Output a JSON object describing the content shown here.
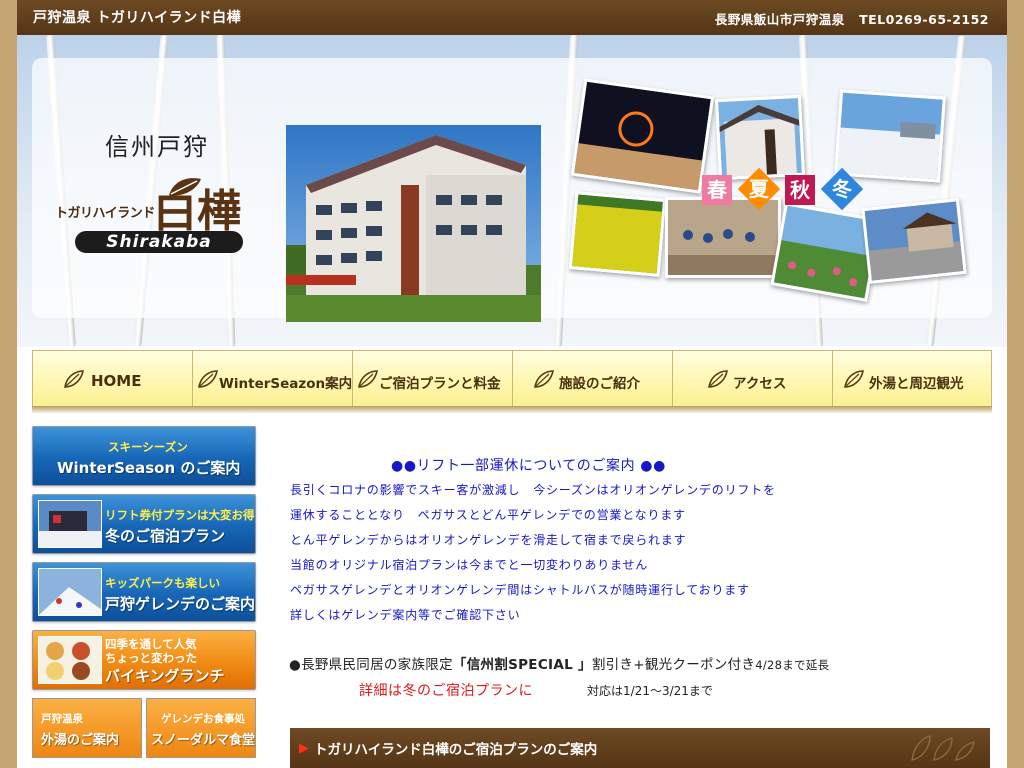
{
  "topbar": {
    "title": "戸狩温泉 トガリハイランド白樺",
    "address": "長野県飯山市戸狩温泉",
    "tel": "TEL0269-65-2152"
  },
  "logo": {
    "kanji": "信州戸狩",
    "sub": "トガリハイランド",
    "main": "白樺",
    "badge": "Shirakaba"
  },
  "seasons": [
    "春",
    "夏",
    "秋",
    "冬"
  ],
  "nav": [
    {
      "label": "HOME"
    },
    {
      "label": "WinterSeazon案内"
    },
    {
      "label": "ご宿泊プランと料金"
    },
    {
      "label": "施設のご紹介"
    },
    {
      "label": "アクセス"
    },
    {
      "label": "外湯と周辺観光"
    }
  ],
  "sidebar": {
    "banners": [
      {
        "top": "スキーシーズン",
        "main": "WinterSeason のご案内"
      },
      {
        "top": "リフト券付プランは大変お得!",
        "main": "冬のご宿泊プラン"
      },
      {
        "top": "キッズパークも楽しい",
        "main": "戸狩ゲレンデのご案内"
      },
      {
        "top": "四季を通して人気",
        "top2": "ちょっと変わった",
        "main": "バイキングランチ"
      }
    ],
    "small_banners": [
      {
        "top": "戸狩温泉",
        "main": "外湯のご案内"
      },
      {
        "top": "ゲレンデお食事処",
        "main": "スノーダルマ食堂"
      }
    ]
  },
  "notice": {
    "heading": "●●リフト一部運休についてのご案内 ●●",
    "lines": [
      "長引くコロナの影響でスキー客が激減し　今シーズンはオリオンゲレンデのリフトを",
      "運休することとなり　ペガサスとどん平ゲレンデでの営業となります",
      "とん平ゲレンデからはオリオンゲレンデを滑走して宿まで戻られます",
      "当館のオリジナル宿泊プランは今までと一切変わりありません",
      "ペガサスゲレンデとオリオンゲレンデ間はシャトルバスが随時運行しております",
      "詳しくはゲレンデ案内等でご確認下さい"
    ]
  },
  "promo": {
    "prefix": "●長野県民同居の家族限定",
    "highlight": "「信州割SPECIAL 」",
    "suffix": "割引き+観光クーポン付き",
    "extension": "4/28まで延長",
    "red_text": "詳細は冬のご宿泊プランに",
    "period": "対応は1/21〜3/21まで"
  },
  "section": {
    "title": "トガリハイランド白樺のご宿泊プランのご案内"
  },
  "colors": {
    "brown": "#553515",
    "nav_yellow": "#fff7b0",
    "banner_blue": "#1766b6",
    "banner_orange": "#f08b14",
    "notice_blue": "#1717c8",
    "promo_red": "#e01818"
  }
}
